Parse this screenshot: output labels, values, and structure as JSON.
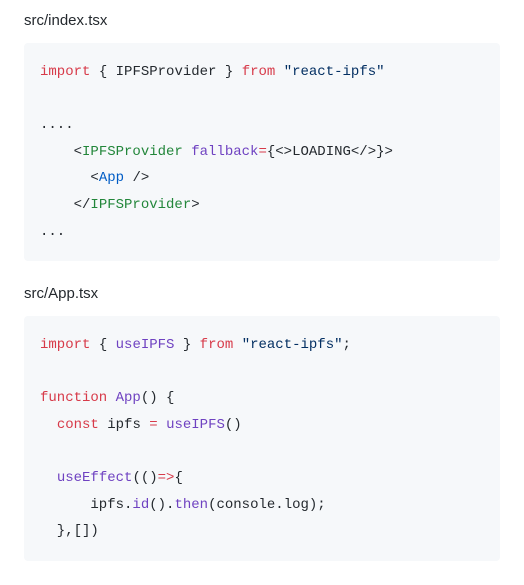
{
  "blocks": [
    {
      "heading": "src/index.tsx",
      "tokens": [
        [
          [
            "kw",
            "import"
          ],
          [
            "plain",
            " { "
          ],
          [
            "plain",
            "IPFSProvider"
          ],
          [
            "plain",
            " } "
          ],
          [
            "kw",
            "from"
          ],
          [
            "plain",
            " "
          ],
          [
            "str",
            "\"react-ipfs\""
          ]
        ],
        [],
        [
          [
            "plain",
            "...."
          ]
        ],
        [
          [
            "plain",
            "    "
          ],
          [
            "plain",
            "<"
          ],
          [
            "tag",
            "IPFSProvider"
          ],
          [
            "plain",
            " "
          ],
          [
            "attr",
            "fallback"
          ],
          [
            "kw",
            "="
          ],
          [
            "plain",
            "{"
          ],
          [
            "plain",
            "<>"
          ],
          [
            "plain",
            "LOADING"
          ],
          [
            "plain",
            "</>"
          ],
          [
            "plain",
            "}>"
          ]
        ],
        [
          [
            "plain",
            "      "
          ],
          [
            "plain",
            "<"
          ],
          [
            "var",
            "App"
          ],
          [
            "plain",
            " />"
          ]
        ],
        [
          [
            "plain",
            "    "
          ],
          [
            "plain",
            "</"
          ],
          [
            "tag",
            "IPFSProvider"
          ],
          [
            "plain",
            ">"
          ]
        ],
        [
          [
            "plain",
            "..."
          ]
        ]
      ]
    },
    {
      "heading": "src/App.tsx",
      "tokens": [
        [
          [
            "kw",
            "import"
          ],
          [
            "plain",
            " { "
          ],
          [
            "type",
            "useIPFS"
          ],
          [
            "plain",
            " } "
          ],
          [
            "kw",
            "from"
          ],
          [
            "plain",
            " "
          ],
          [
            "str",
            "\"react-ipfs\""
          ],
          [
            "plain",
            ";"
          ]
        ],
        [],
        [
          [
            "kw",
            "function"
          ],
          [
            "plain",
            " "
          ],
          [
            "type",
            "App"
          ],
          [
            "plain",
            "() {"
          ]
        ],
        [
          [
            "plain",
            "  "
          ],
          [
            "kw",
            "const"
          ],
          [
            "plain",
            " "
          ],
          [
            "plain",
            "ipfs"
          ],
          [
            "plain",
            " "
          ],
          [
            "kw",
            "="
          ],
          [
            "plain",
            " "
          ],
          [
            "type",
            "useIPFS"
          ],
          [
            "plain",
            "()"
          ]
        ],
        [],
        [
          [
            "plain",
            "  "
          ],
          [
            "type",
            "useEffect"
          ],
          [
            "plain",
            "(()"
          ],
          [
            "kw",
            "=>"
          ],
          [
            "plain",
            "{"
          ]
        ],
        [
          [
            "plain",
            "      ipfs."
          ],
          [
            "type",
            "id"
          ],
          [
            "plain",
            "()."
          ],
          [
            "type",
            "then"
          ],
          [
            "plain",
            "(console."
          ],
          [
            "plain",
            "log"
          ],
          [
            "plain",
            ");"
          ]
        ],
        [
          [
            "plain",
            "  },[])"
          ]
        ]
      ]
    }
  ]
}
